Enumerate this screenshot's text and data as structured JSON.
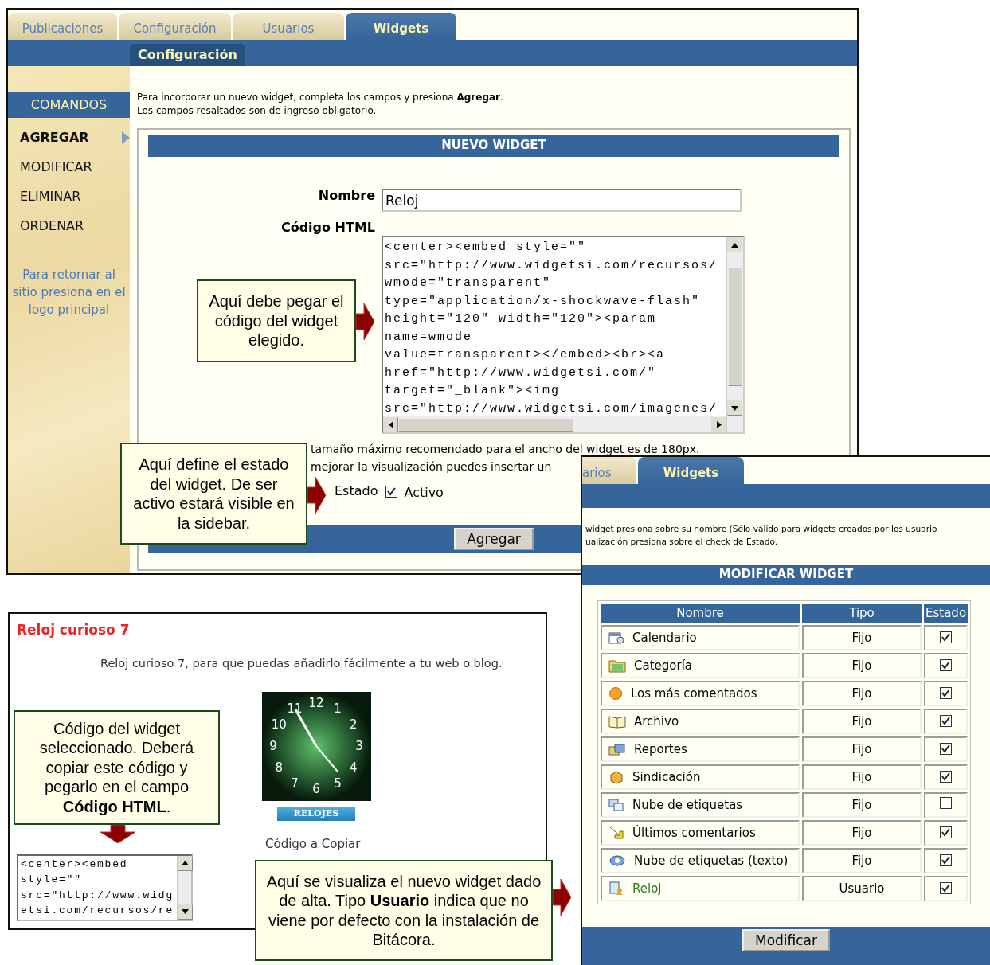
{
  "window_main": {
    "tabs": [
      {
        "label": "Publicaciones",
        "selected": false
      },
      {
        "label": "Configuración",
        "selected": false
      },
      {
        "label": "Usuarios",
        "selected": false
      },
      {
        "label": "Widgets",
        "selected": true
      }
    ],
    "subtab": "Configuración",
    "sidebar": {
      "title": "COMANDOS",
      "items": [
        {
          "label": "AGREGAR",
          "selected": true
        },
        {
          "label": "MODIFICAR",
          "selected": false
        },
        {
          "label": "ELIMINAR",
          "selected": false
        },
        {
          "label": "ORDENAR",
          "selected": false
        }
      ],
      "note": "Para retornar al sitio presiona en el logo principal"
    },
    "intro_lines": [
      "Para incorporar un nuevo widget, completa los campos y presiona **Agregar**.",
      "Los campos resaltados son de ingreso obligatorio."
    ],
    "form": {
      "title": "NUEVO WIDGET",
      "name_label": "Nombre",
      "name_value": "Reloj",
      "code_label": "Código HTML",
      "code_lines": [
        "<center><embed style=\"\"",
        "src=\"http://www.widgetsi.com/recursos/",
        "wmode=\"transparent\"",
        "type=\"application/x-shockwave-flash\"",
        "height=\"120\" width=\"120\"><param",
        "name=wmode",
        "value=transparent></embed><br><a",
        "href=\"http://www.widgetsi.com/\"",
        "target=\"_blank\"><img",
        "src=\"http://www.widgetsi.com/imagenes/"
      ],
      "notes": [
        "tamaño máximo recomendado para el ancho del widget es de 180px.",
        "mejorar la visualización puedes insertar un"
      ],
      "status_label": "Estado",
      "active": {
        "label": "Activo",
        "checked": true
      },
      "submit": "Agregar"
    }
  },
  "window_list": {
    "tabs": [
      {
        "label": "arios",
        "selected": false
      },
      {
        "label": "Widgets",
        "selected": true
      }
    ],
    "intro_lines": [
      "widget presiona sobre su nombre (Sólo válido para widgets creados por los usuario",
      "ualización presiona sobre el check de Estado."
    ],
    "title": "MODIFICAR WIDGET",
    "columns": [
      "Nombre",
      "Tipo",
      "Estado"
    ],
    "rows": [
      {
        "name": "Calendario",
        "type": "Fijo",
        "active": true,
        "linked": false
      },
      {
        "name": "Categoría",
        "type": "Fijo",
        "active": true,
        "linked": false
      },
      {
        "name": "Los más comentados",
        "type": "Fijo",
        "active": true,
        "linked": false
      },
      {
        "name": "Archivo",
        "type": "Fijo",
        "active": true,
        "linked": false
      },
      {
        "name": "Reportes",
        "type": "Fijo",
        "active": true,
        "linked": false
      },
      {
        "name": "Sindicación",
        "type": "Fijo",
        "active": true,
        "linked": false
      },
      {
        "name": "Nube de etiquetas",
        "type": "Fijo",
        "active": false,
        "linked": false
      },
      {
        "name": "Últimos comentarios",
        "type": "Fijo",
        "active": true,
        "linked": false
      },
      {
        "name": "Nube de etiquetas (texto)",
        "type": "Fijo",
        "active": true,
        "linked": false
      },
      {
        "name": "Reloj",
        "type": "Usuario",
        "active": true,
        "linked": true
      }
    ],
    "submit": "Modificar"
  },
  "window_widget": {
    "title": "Reloj curioso 7",
    "description": "Reloj curioso 7, para que puedas añadirlo fácilmente a tu web o blog.",
    "clock_numerals": [
      "11",
      "12",
      "1",
      "10",
      "2",
      "9",
      "3",
      "8",
      "4",
      "7",
      "6",
      "5"
    ],
    "banner": "RELOJES",
    "caption": "Código a Copiar",
    "code_lines": [
      "<center><embed",
      "style=\"\"",
      "src=\"http://www.widg",
      "etsi.com/recursos/re"
    ]
  },
  "callouts": [
    {
      "text": "Aquí debe pegar el código del widget elegido.",
      "kind": "right"
    },
    {
      "text": "Aquí define el estado del widget. De ser activo estará visible en la sidebar.",
      "kind": "right"
    },
    {
      "text": "Código del widget seleccionado. Deberá copiar este código y pegarlo en el campo **Código HTML**.",
      "kind": "down"
    },
    {
      "text": "Aquí se visualiza el nuevo widget dado de alta. Tipo **Usuario** indica que no viene por defecto con la instalación de Bitácora.",
      "kind": "right"
    }
  ]
}
